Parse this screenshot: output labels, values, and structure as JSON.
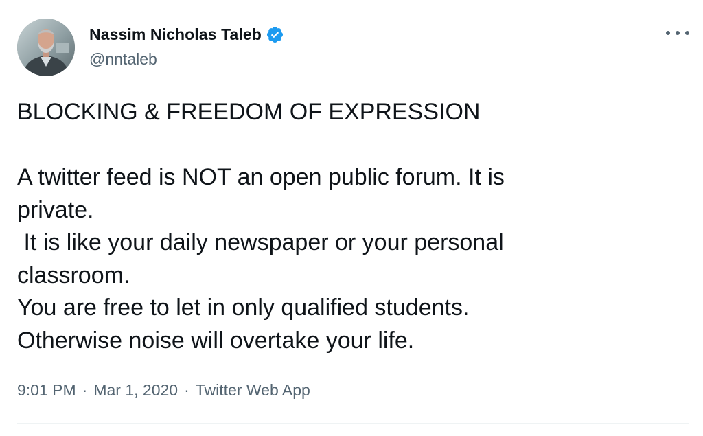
{
  "user": {
    "display_name": "Nassim Nicholas Taleb",
    "handle": "@nntaleb",
    "verified": true,
    "verified_icon": "verified-badge-icon",
    "verified_color": "#1d9bf0"
  },
  "tweet": {
    "text": "BLOCKING & FREEDOM OF EXPRESSION\n\nA twitter feed is NOT an open public forum. It is\nprivate.\n It is like your daily newspaper or your personal\nclassroom.\nYou are free to let in only qualified students.\nOtherwise noise will overtake your life."
  },
  "meta": {
    "time": "9:01 PM",
    "date": "Mar 1, 2020",
    "source": "Twitter Web App",
    "separator": "·"
  },
  "actions": {
    "more_icon": "more-horizontal-icon"
  },
  "colors": {
    "text_primary": "#0f1419",
    "text_secondary": "#536471",
    "divider": "#eff3f4"
  }
}
